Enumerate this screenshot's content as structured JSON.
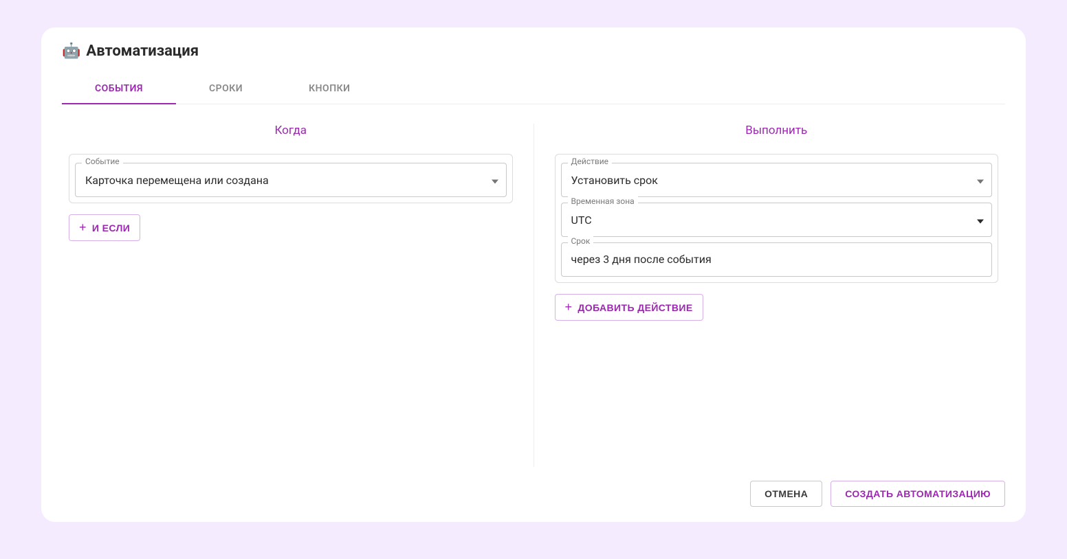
{
  "header": {
    "emoji": "🤖",
    "title": "Автоматизация"
  },
  "tabs": [
    {
      "label": "СОБЫТИЯ",
      "active": true
    },
    {
      "label": "СРОКИ",
      "active": false
    },
    {
      "label": "КНОПКИ",
      "active": false
    }
  ],
  "when": {
    "title": "Когда",
    "event_label": "Событие",
    "event_value": "Карточка перемещена или создана",
    "and_if_label": "И ЕСЛИ"
  },
  "execute": {
    "title": "Выполнить",
    "action_label": "Действие",
    "action_value": "Установить срок",
    "timezone_label": "Временная зона",
    "timezone_value": "UTC",
    "deadline_label": "Срок",
    "deadline_value": "через 3 дня после события",
    "add_action_label": "ДОБАВИТЬ ДЕЙСТВИЕ"
  },
  "footer": {
    "cancel": "ОТМЕНА",
    "create": "СОЗДАТЬ АВТОМАТИЗАЦИЮ"
  }
}
